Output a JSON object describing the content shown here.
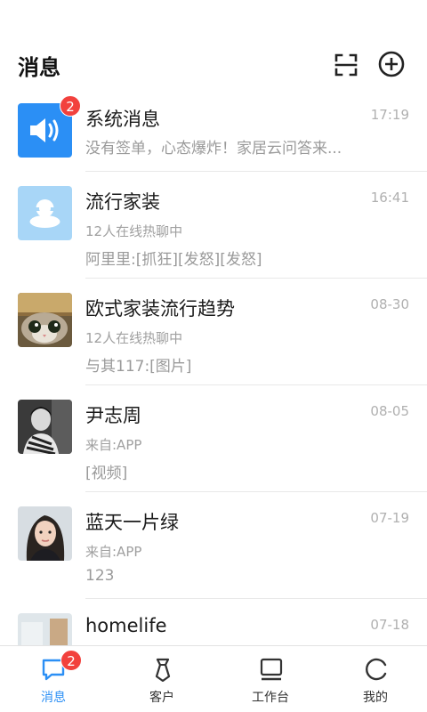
{
  "header": {
    "title": "消息",
    "scan_icon": "scan-icon",
    "add_icon": "plus-circle-icon"
  },
  "colors": {
    "accent": "#2b8ff5",
    "badge": "#f2413d",
    "system_avatar": "#2b8ff5",
    "group_avatar": "#a8d6f7"
  },
  "conversations": [
    {
      "name": "系统消息",
      "time": "17:19",
      "preview": "没有签单，心态爆炸！家居云问答来...",
      "badge": "2",
      "avatar": "speaker-icon"
    },
    {
      "name": "流行家装",
      "time": "16:41",
      "subtitle": "12人在线热聊中",
      "preview": "阿里里:[抓狂][发怒][发怒]",
      "avatar": "group-icon"
    },
    {
      "name": "欧式家装流行趋势",
      "time": "08-30",
      "subtitle": "12人在线热聊中",
      "preview": "与其117:[图片]",
      "avatar": "cat-photo"
    },
    {
      "name": "尹志周",
      "time": "08-05",
      "subtitle": "来自:APP",
      "preview": "[视频]",
      "avatar": "person-photo-bw"
    },
    {
      "name": "蓝天一片绿",
      "time": "07-19",
      "subtitle": "来自:APP",
      "preview": "123",
      "avatar": "person-photo"
    },
    {
      "name": "homelife",
      "time": "07-18",
      "avatar": "room-photo"
    }
  ],
  "tabbar": {
    "tabs": [
      {
        "label": "消息",
        "icon": "chat-icon",
        "badge": "2",
        "active": true
      },
      {
        "label": "客户",
        "icon": "tie-icon"
      },
      {
        "label": "工作台",
        "icon": "monitor-icon"
      },
      {
        "label": "我的",
        "icon": "profile-ring-icon"
      }
    ]
  }
}
